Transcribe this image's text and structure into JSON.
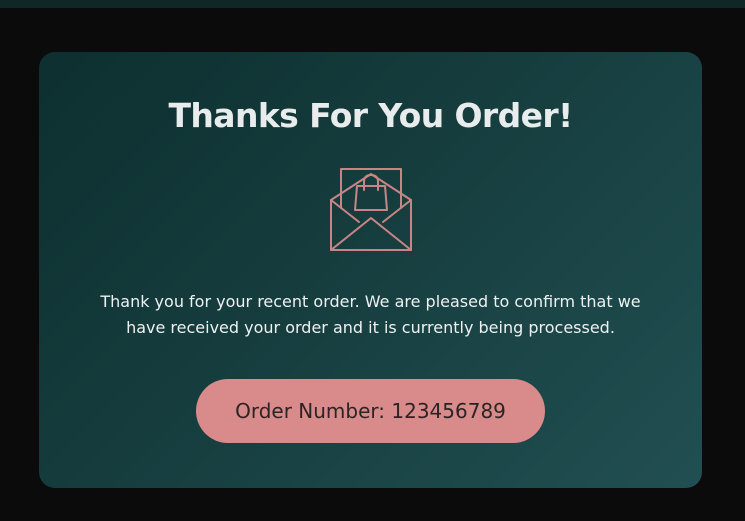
{
  "colors": {
    "background": "#0b0b0b",
    "card_gradient_start": "#0d2f2f",
    "card_gradient_end": "#214f52",
    "accent_pink": "#d98a8a",
    "title_text": "#e9ecec"
  },
  "confirmation": {
    "title": "Thanks For You Order!",
    "icon": "envelope-with-shopping-bag-icon",
    "message": "Thank you for your recent order. We are pleased to confirm that we have received your order and it is currently being processed.",
    "order_label": "Order Number: 123456789"
  }
}
